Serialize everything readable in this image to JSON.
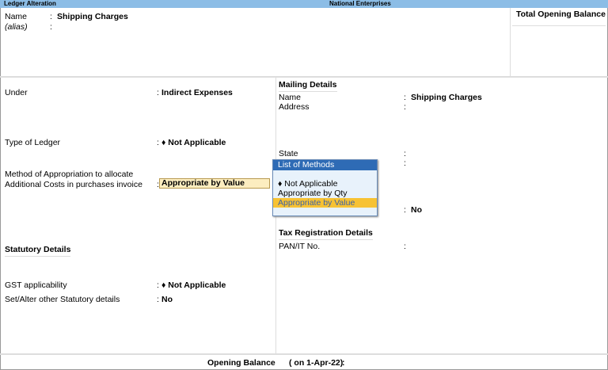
{
  "titlebar": {
    "left": "Ledger Alteration",
    "center": "National Enterprises"
  },
  "header": {
    "name_label": "Name",
    "name_value": "Shipping Charges",
    "alias_label": "(alias)",
    "total_opening_balance": "Total Opening Balance"
  },
  "left": {
    "under_label": "Under",
    "under_value": "Indirect Expenses",
    "type_label": "Type of Ledger",
    "type_value": "♦ Not Applicable",
    "method_label1": "Method of Appropriation to allocate",
    "method_label2": "Additional Costs in purchases invoice",
    "method_value": "Appropriate by Value",
    "statutory_heading": "Statutory Details",
    "gst_label": "GST applicability",
    "gst_value": "♦ Not Applicable",
    "setalter_label": "Set/Alter other Statutory details",
    "setalter_value": "No"
  },
  "right": {
    "mailing_heading": "Mailing Details",
    "name_label": "Name",
    "name_value": "Shipping Charges",
    "address_label": "Address",
    "state_label": "State",
    "hidden_value": "No",
    "tax_heading": "Tax Registration Details",
    "pan_label": "PAN/IT No."
  },
  "popup": {
    "title": "List of Methods",
    "options": [
      "♦ Not Applicable",
      "Appropriate by Qty",
      "Appropriate by Value"
    ],
    "selected": "Appropriate by Value"
  },
  "footer": {
    "label": "Opening Balance",
    "date": "( on 1-Apr-22)",
    "colon": ":"
  }
}
